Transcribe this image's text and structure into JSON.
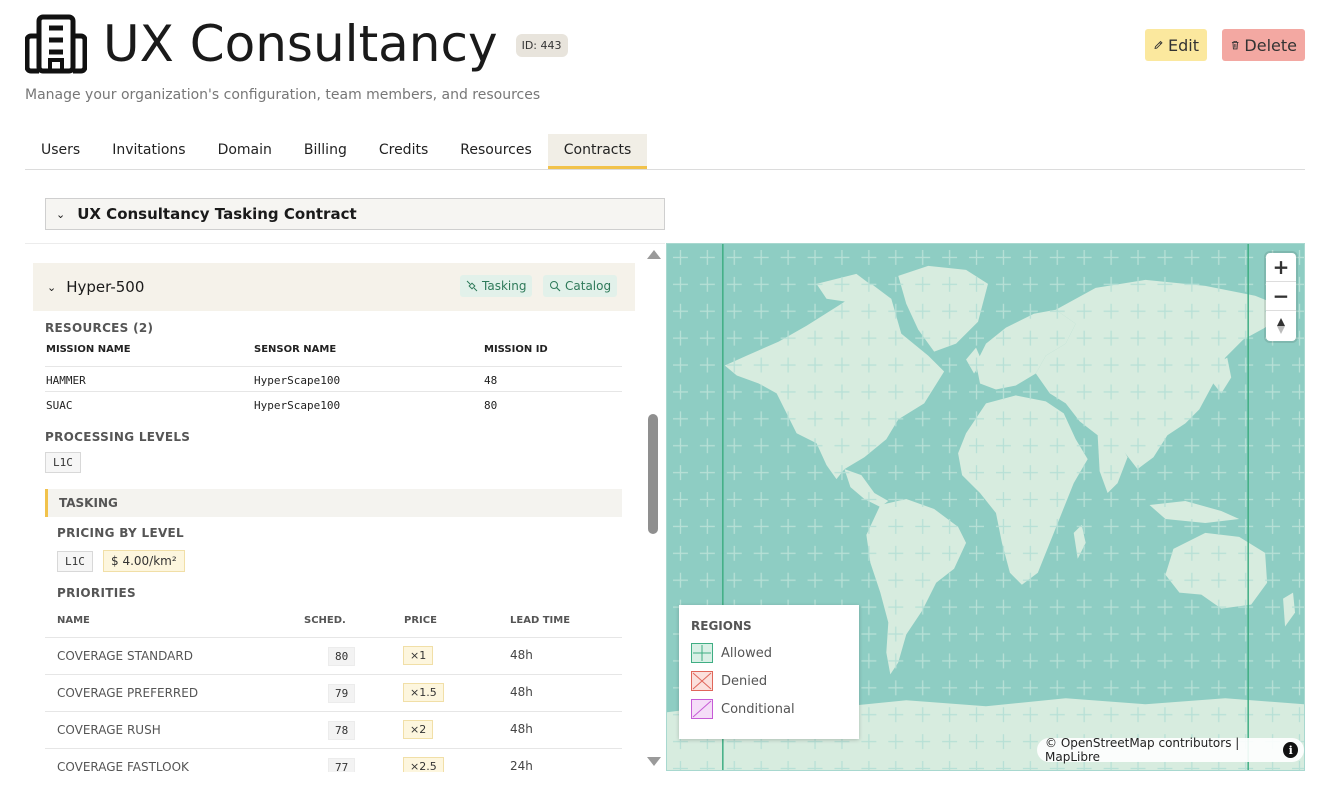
{
  "header": {
    "title": "UX Consultancy",
    "id_badge": "ID: 443",
    "subtitle": "Manage your organization's configuration, team members, and resources",
    "edit_label": "Edit",
    "delete_label": "Delete"
  },
  "tabs": [
    {
      "label": "Users",
      "active": false
    },
    {
      "label": "Invitations",
      "active": false
    },
    {
      "label": "Domain",
      "active": false
    },
    {
      "label": "Billing",
      "active": false
    },
    {
      "label": "Credits",
      "active": false
    },
    {
      "label": "Resources",
      "active": false
    },
    {
      "label": "Contracts",
      "active": true
    }
  ],
  "contract": {
    "title": "UX Consultancy Tasking Contract"
  },
  "product": {
    "name": "Hyper-500",
    "tasking_chip": "Tasking",
    "catalog_chip": "Catalog",
    "resources_label": "RESOURCES (2)",
    "resource_columns": [
      "MISSION NAME",
      "SENSOR NAME",
      "MISSION ID"
    ],
    "resources": [
      {
        "mission": "HAMMER",
        "sensor": "HyperScape100",
        "id": "48"
      },
      {
        "mission": "SUAC",
        "sensor": "HyperScape100",
        "id": "80"
      }
    ],
    "processing_label": "PROCESSING LEVELS",
    "processing_levels": [
      "L1C"
    ],
    "tasking_label": "TASKING",
    "pricing_label": "PRICING BY LEVEL",
    "pricing_level": "L1C",
    "pricing_value": "$ 4.00/km²",
    "priorities_label": "PRIORITIES",
    "priority_columns": [
      "NAME",
      "SCHED.",
      "PRICE",
      "LEAD TIME"
    ],
    "priorities": [
      {
        "name": "COVERAGE STANDARD",
        "sched": "80",
        "price": "×1",
        "lead": "48h"
      },
      {
        "name": "COVERAGE PREFERRED",
        "sched": "79",
        "price": "×1.5",
        "lead": "48h"
      },
      {
        "name": "COVERAGE RUSH",
        "sched": "78",
        "price": "×2",
        "lead": "48h"
      },
      {
        "name": "COVERAGE FASTLOOK",
        "sched": "77",
        "price": "×2.5",
        "lead": "24h"
      }
    ]
  },
  "map": {
    "zoom_in": "+",
    "zoom_out": "−",
    "legend_title": "REGIONS",
    "legend": [
      {
        "label": "Allowed",
        "color": "#3fae83"
      },
      {
        "label": "Denied",
        "color": "#e0665a"
      },
      {
        "label": "Conditional",
        "color": "#c65bd6"
      }
    ],
    "attribution": "© OpenStreetMap contributors | MapLibre",
    "info": "i",
    "water_color": "#8ecdc3",
    "land_color": "#d7ecdf"
  }
}
